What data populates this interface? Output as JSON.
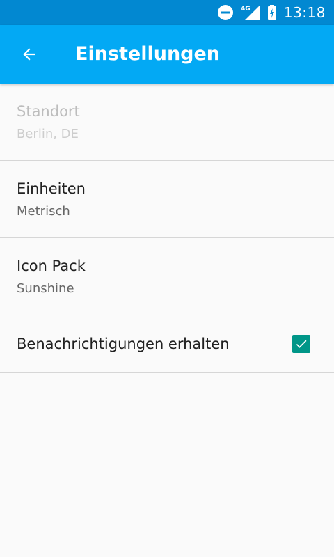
{
  "status_bar": {
    "network": "4G",
    "time": "13:18",
    "icons": [
      "do-not-disturb-icon",
      "signal-icon",
      "battery-charging-icon"
    ]
  },
  "app_bar": {
    "title": "Einstellungen",
    "back_icon": "arrow-back-icon"
  },
  "settings": {
    "location": {
      "title": "Standort",
      "summary": "Berlin, DE",
      "enabled": false
    },
    "units": {
      "title": "Einheiten",
      "summary": "Metrisch"
    },
    "icon_pack": {
      "title": "Icon Pack",
      "summary": "Sunshine"
    },
    "notifications": {
      "title": "Benachrichtigungen erhalten",
      "checked": true
    }
  },
  "colors": {
    "status_bar": "#0288d1",
    "app_bar": "#03a9f4",
    "checkbox": "#009688",
    "background": "#fafafa"
  }
}
